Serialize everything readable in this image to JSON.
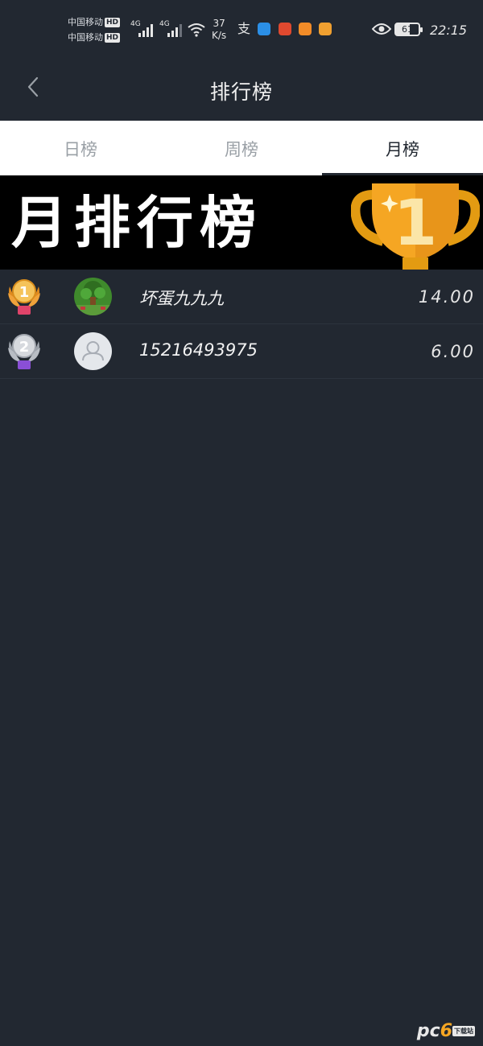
{
  "status_bar": {
    "carrier1": "中国移动",
    "carrier2": "中国移动",
    "hd": "HD",
    "signal1": "4G",
    "signal2": "4G",
    "net_speed_value": "37",
    "net_speed_unit": "K/s",
    "battery": "61",
    "time": "22:15"
  },
  "header": {
    "title": "排行榜"
  },
  "tabs": [
    {
      "label": "日榜",
      "active": false
    },
    {
      "label": "周榜",
      "active": false
    },
    {
      "label": "月榜",
      "active": true
    }
  ],
  "banner": {
    "text": "月排行榜",
    "trophy_number": "1"
  },
  "rankings": [
    {
      "rank": "1",
      "name": "坏蛋九九九",
      "score": "14.00"
    },
    {
      "rank": "2",
      "name": "15216493975",
      "score": "6.00"
    }
  ],
  "watermark": {
    "brand_a": "pc",
    "brand_b": "6",
    "brand_small": "下载站"
  },
  "colors": {
    "background": "#222831",
    "tab_bg": "#ffffff",
    "banner_bg": "#000000",
    "gold": "#f5a623",
    "silver": "#c0c4ca"
  }
}
